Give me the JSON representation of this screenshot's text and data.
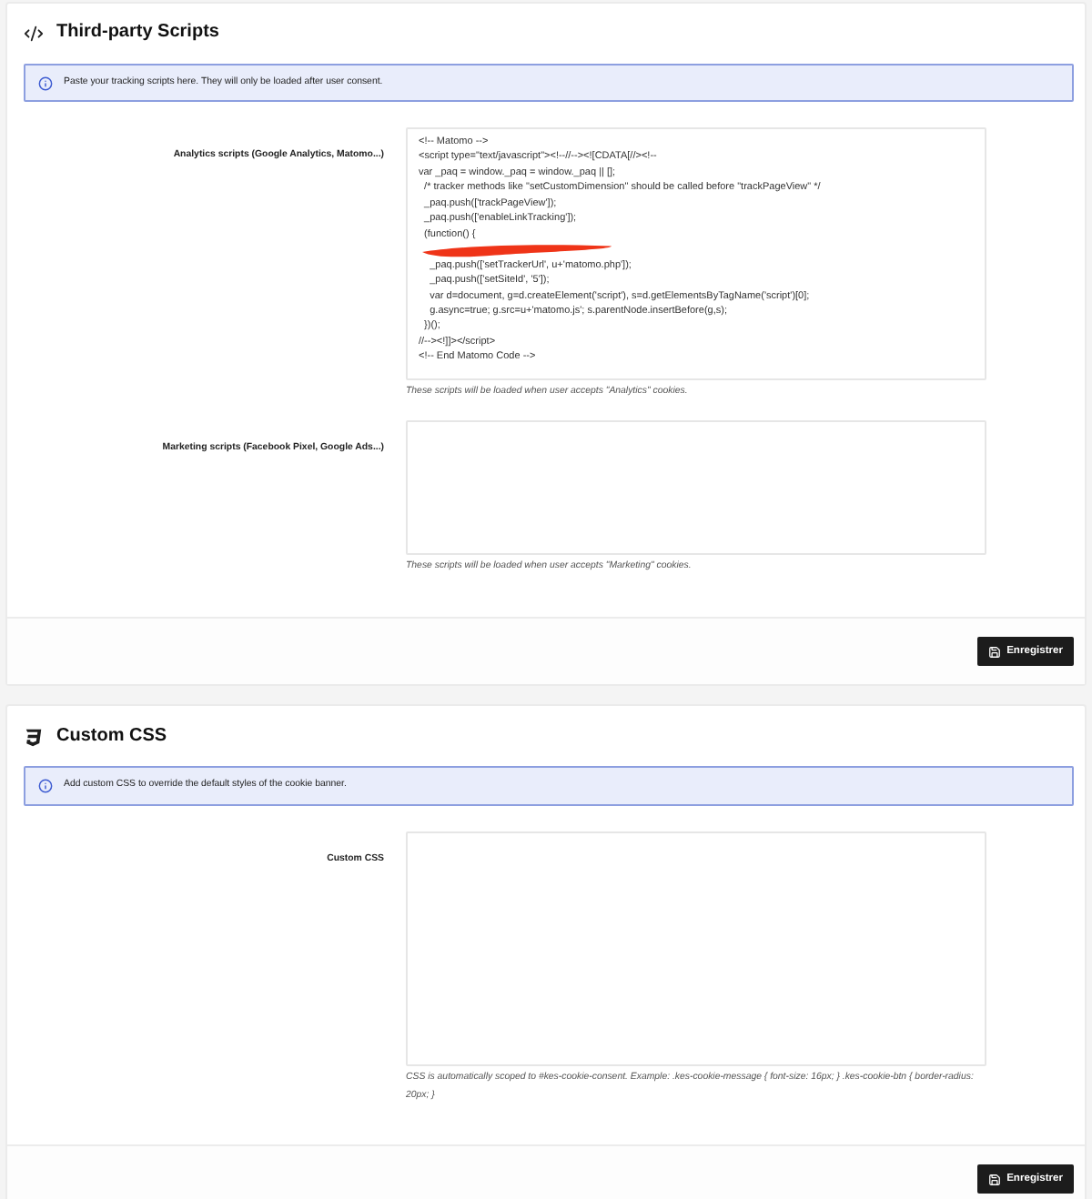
{
  "sections": [
    {
      "kind": "scripts",
      "title": "Third-party Scripts",
      "notice": "Paste your tracking scripts here. They will only be loaded after user consent.",
      "fields": [
        {
          "label": "Analytics scripts (Google Analytics, Matomo...)",
          "lines": [
            {
              "kind": "text",
              "text": "<!-- Matomo -->"
            },
            {
              "kind": "text",
              "text": "<script type=\"text/javascript\"><!--//--><![CDATA[//><!--"
            },
            {
              "kind": "text",
              "text": "var _paq = window._paq = window._paq || [];"
            },
            {
              "kind": "text",
              "text": "  /* tracker methods like \"setCustomDimension\" should be called before \"trackPageView\" */"
            },
            {
              "kind": "text",
              "text": "  _paq.push(['trackPageView']);"
            },
            {
              "kind": "text",
              "text": "  _paq.push(['enableLinkTracking']);"
            },
            {
              "kind": "text",
              "text": "  (function() {"
            },
            {
              "kind": "redacted"
            },
            {
              "kind": "text",
              "text": "    _paq.push(['setTrackerUrl', u+'matomo.php']);"
            },
            {
              "kind": "text",
              "text": "    _paq.push(['setSiteId', '5']);"
            },
            {
              "kind": "text",
              "text": "    var d=document, g=d.createElement('script'), s=d.getElementsByTagName('script')[0];"
            },
            {
              "kind": "text",
              "text": "    g.async=true; g.src=u+'matomo.js'; s.parentNode.insertBefore(g,s);"
            },
            {
              "kind": "text",
              "text": "  })();"
            },
            {
              "kind": "text",
              "text": "//--><!]]></script>"
            },
            {
              "kind": "text",
              "text": "<!-- End Matomo Code -->"
            }
          ],
          "help": "These scripts will be loaded when user accepts \"Analytics\" cookies."
        },
        {
          "label": "Marketing scripts (Facebook Pixel, Google Ads...)",
          "help": "These scripts will be loaded when user accepts \"Marketing\" cookies."
        }
      ],
      "button": "Enregistrer"
    },
    {
      "kind": "css",
      "title": "Custom CSS",
      "notice": "Add custom CSS to override the default styles of the cookie banner.",
      "fields": [
        {
          "label": "Custom CSS",
          "help": "CSS is automatically scoped to #kes-cookie-consent. Example: .kes-cookie-message { font-size: 16px; } .kes-cookie-btn { border-radius: 20px; }"
        }
      ],
      "button": "Enregistrer"
    }
  ]
}
